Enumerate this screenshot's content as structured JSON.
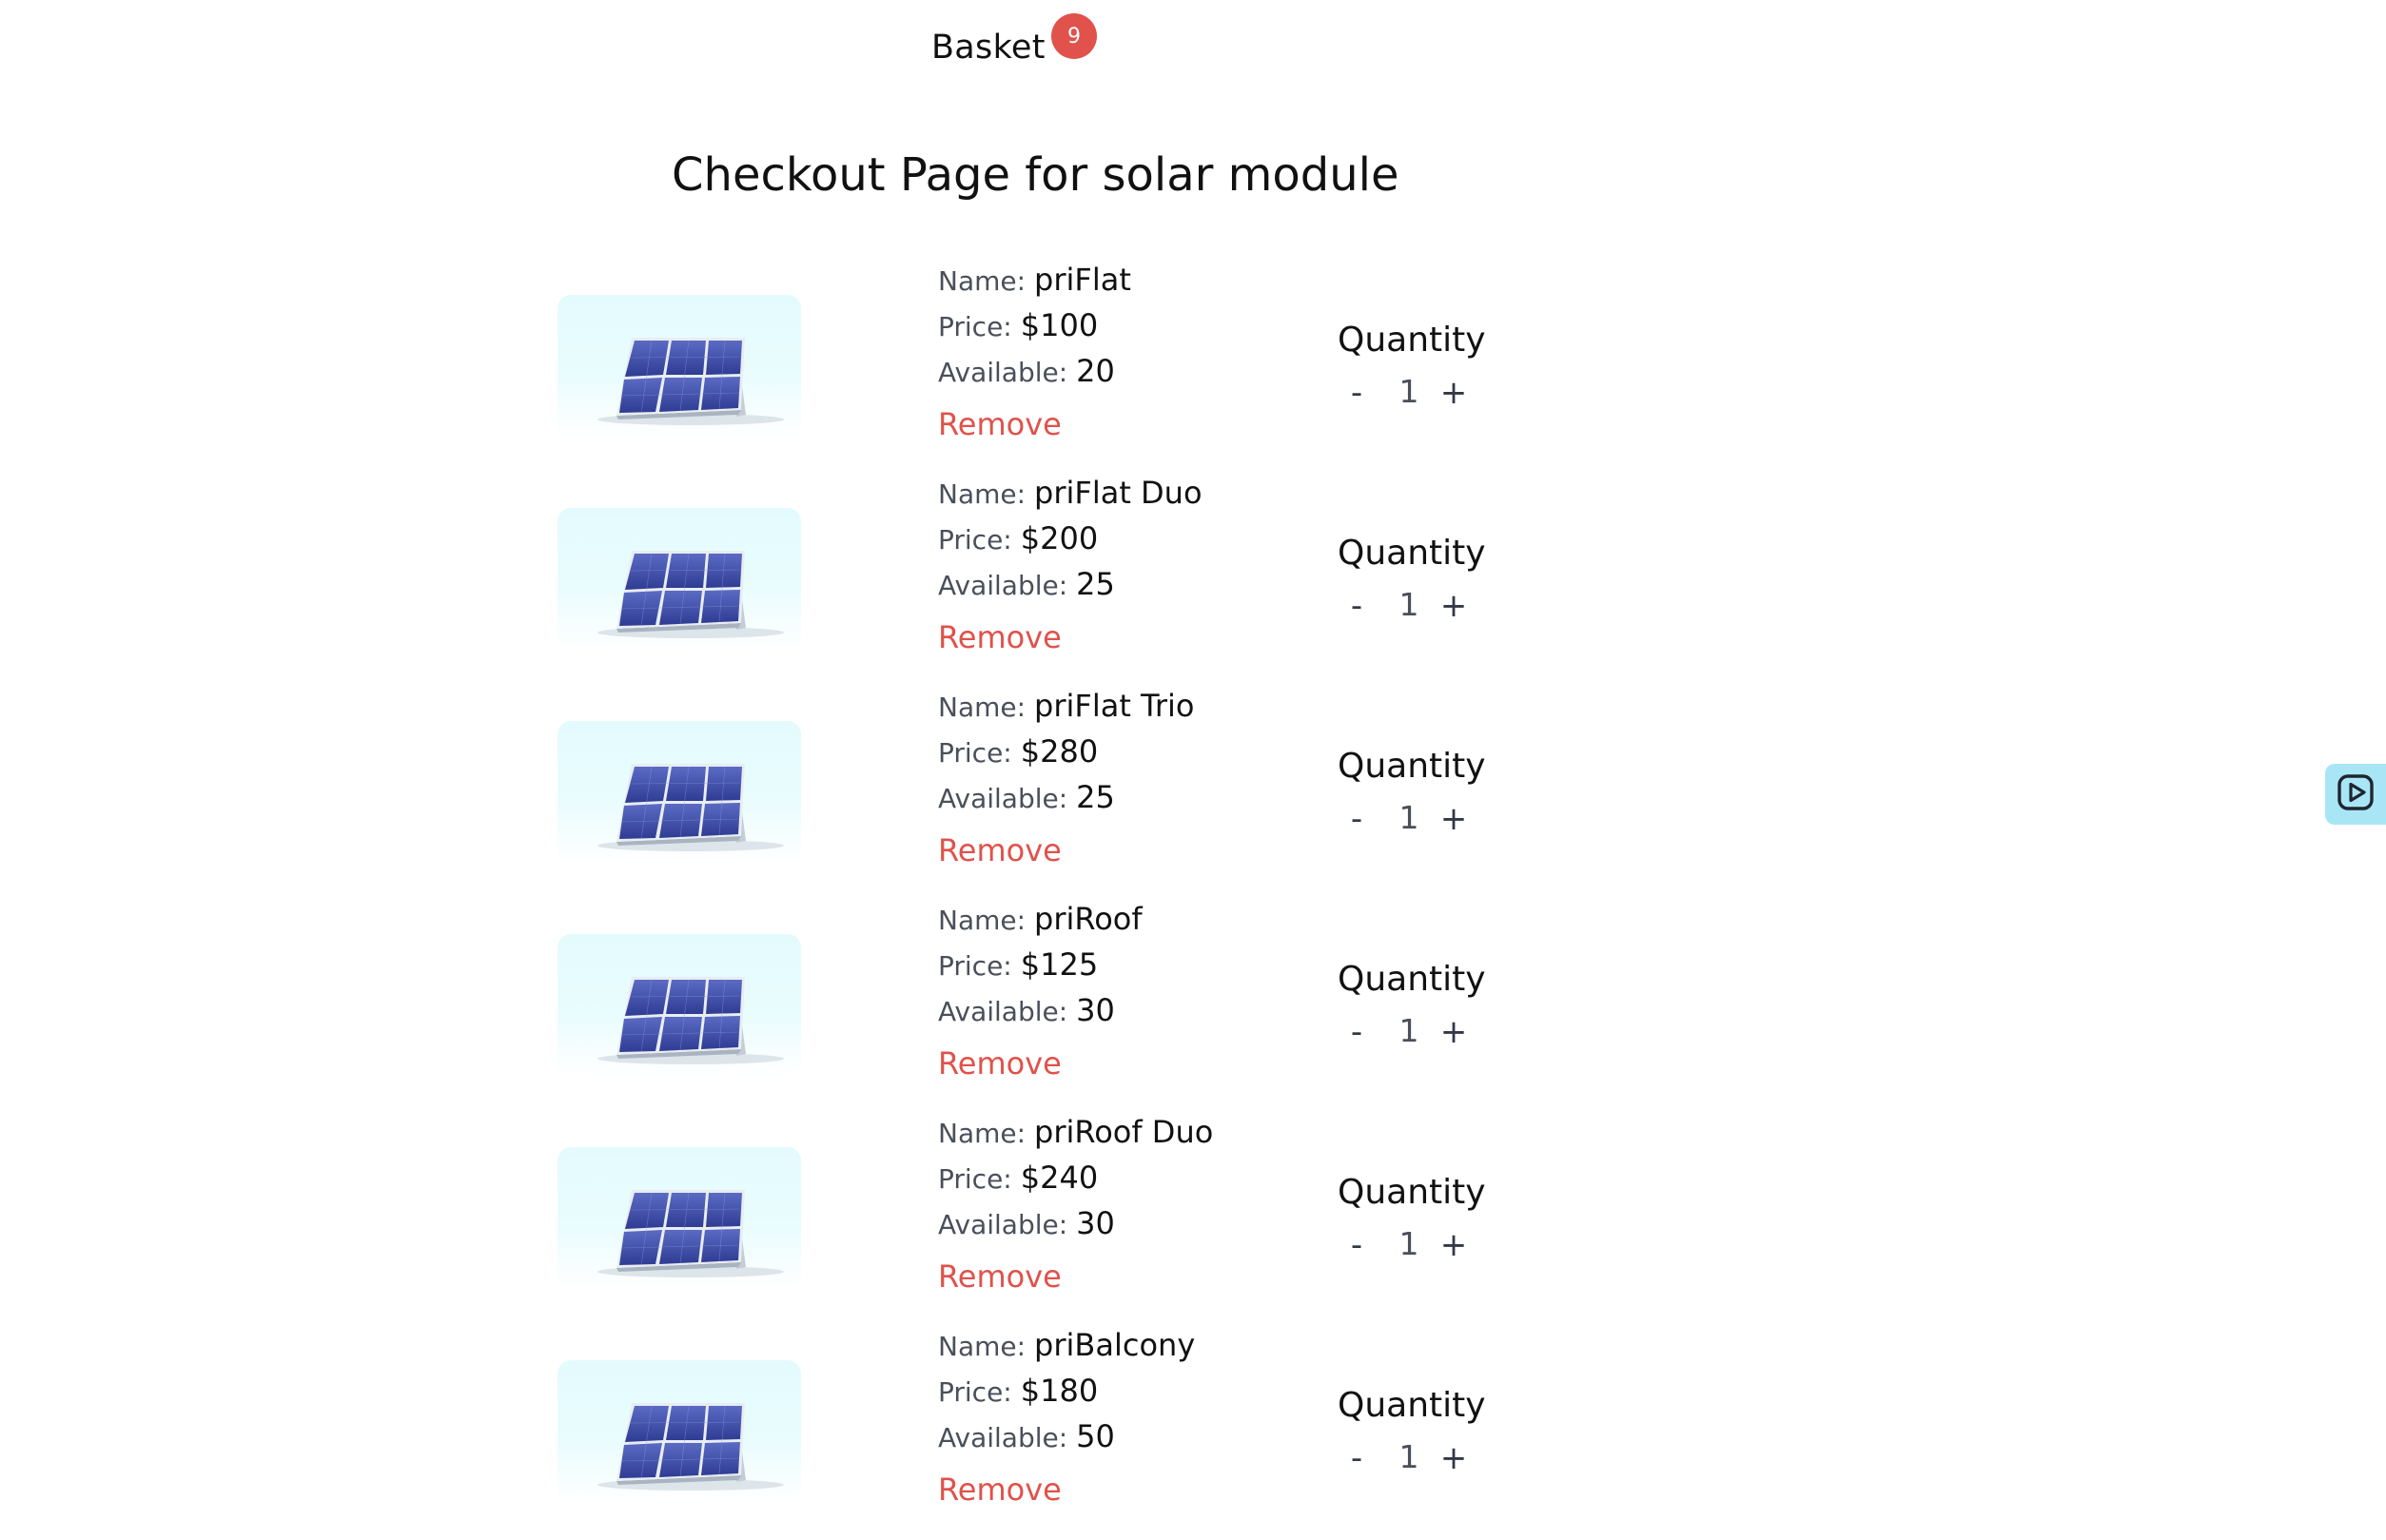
{
  "header": {
    "basket_label": "Basket",
    "basket_count": "9"
  },
  "page": {
    "title": "Checkout Page for solar module"
  },
  "labels": {
    "name": "Name:",
    "price": "Price:",
    "available": "Available:",
    "remove": "Remove",
    "quantity": "Quantity",
    "minus": "-",
    "plus": "+"
  },
  "items": [
    {
      "name": "priFlat",
      "price": "$100",
      "available": "20",
      "quantity": "1"
    },
    {
      "name": "priFlat Duo",
      "price": "$200",
      "available": "25",
      "quantity": "1"
    },
    {
      "name": "priFlat Trio",
      "price": "$280",
      "available": "25",
      "quantity": "1"
    },
    {
      "name": "priRoof",
      "price": "$125",
      "available": "30",
      "quantity": "1"
    },
    {
      "name": "priRoof Duo",
      "price": "$240",
      "available": "30",
      "quantity": "1"
    },
    {
      "name": "priBalcony",
      "price": "$180",
      "available": "50",
      "quantity": "1"
    }
  ],
  "icons": {
    "product_image": "solar-panel-icon",
    "side_tab": "play-video-icon"
  },
  "colors": {
    "accent_red": "#e0524b",
    "side_tab_bg": "#a8e6f5",
    "thumb_bg": "#e4fbfd"
  }
}
